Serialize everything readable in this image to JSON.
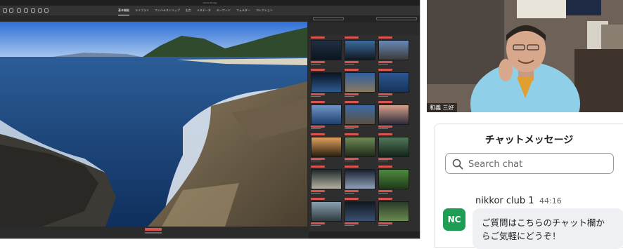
{
  "shared_screen": {
    "window_title": "Adobe Bridge",
    "menu": [
      "基本機能",
      "ライブラリ",
      "フィルムストリップ",
      "出力",
      "メタデータ",
      "キーワード",
      "フォルダー",
      "コレクション"
    ],
    "active_menu": "基本機能",
    "panel_tab": "コンテンツ"
  },
  "video": {
    "participant_name": "和義 三好"
  },
  "chat": {
    "title": "チャットメッセージ",
    "search": {
      "placeholder": "Search chat",
      "icon": "magnifier-icon"
    },
    "messages": [
      {
        "avatar_initials": "NC",
        "avatar_color": "#1e9e55",
        "sender": "nikkor club 1",
        "time": "44:16",
        "line1": "ご質問はこちらのチャット欄か",
        "line2": "らご気軽にどうぞ！"
      }
    ]
  }
}
